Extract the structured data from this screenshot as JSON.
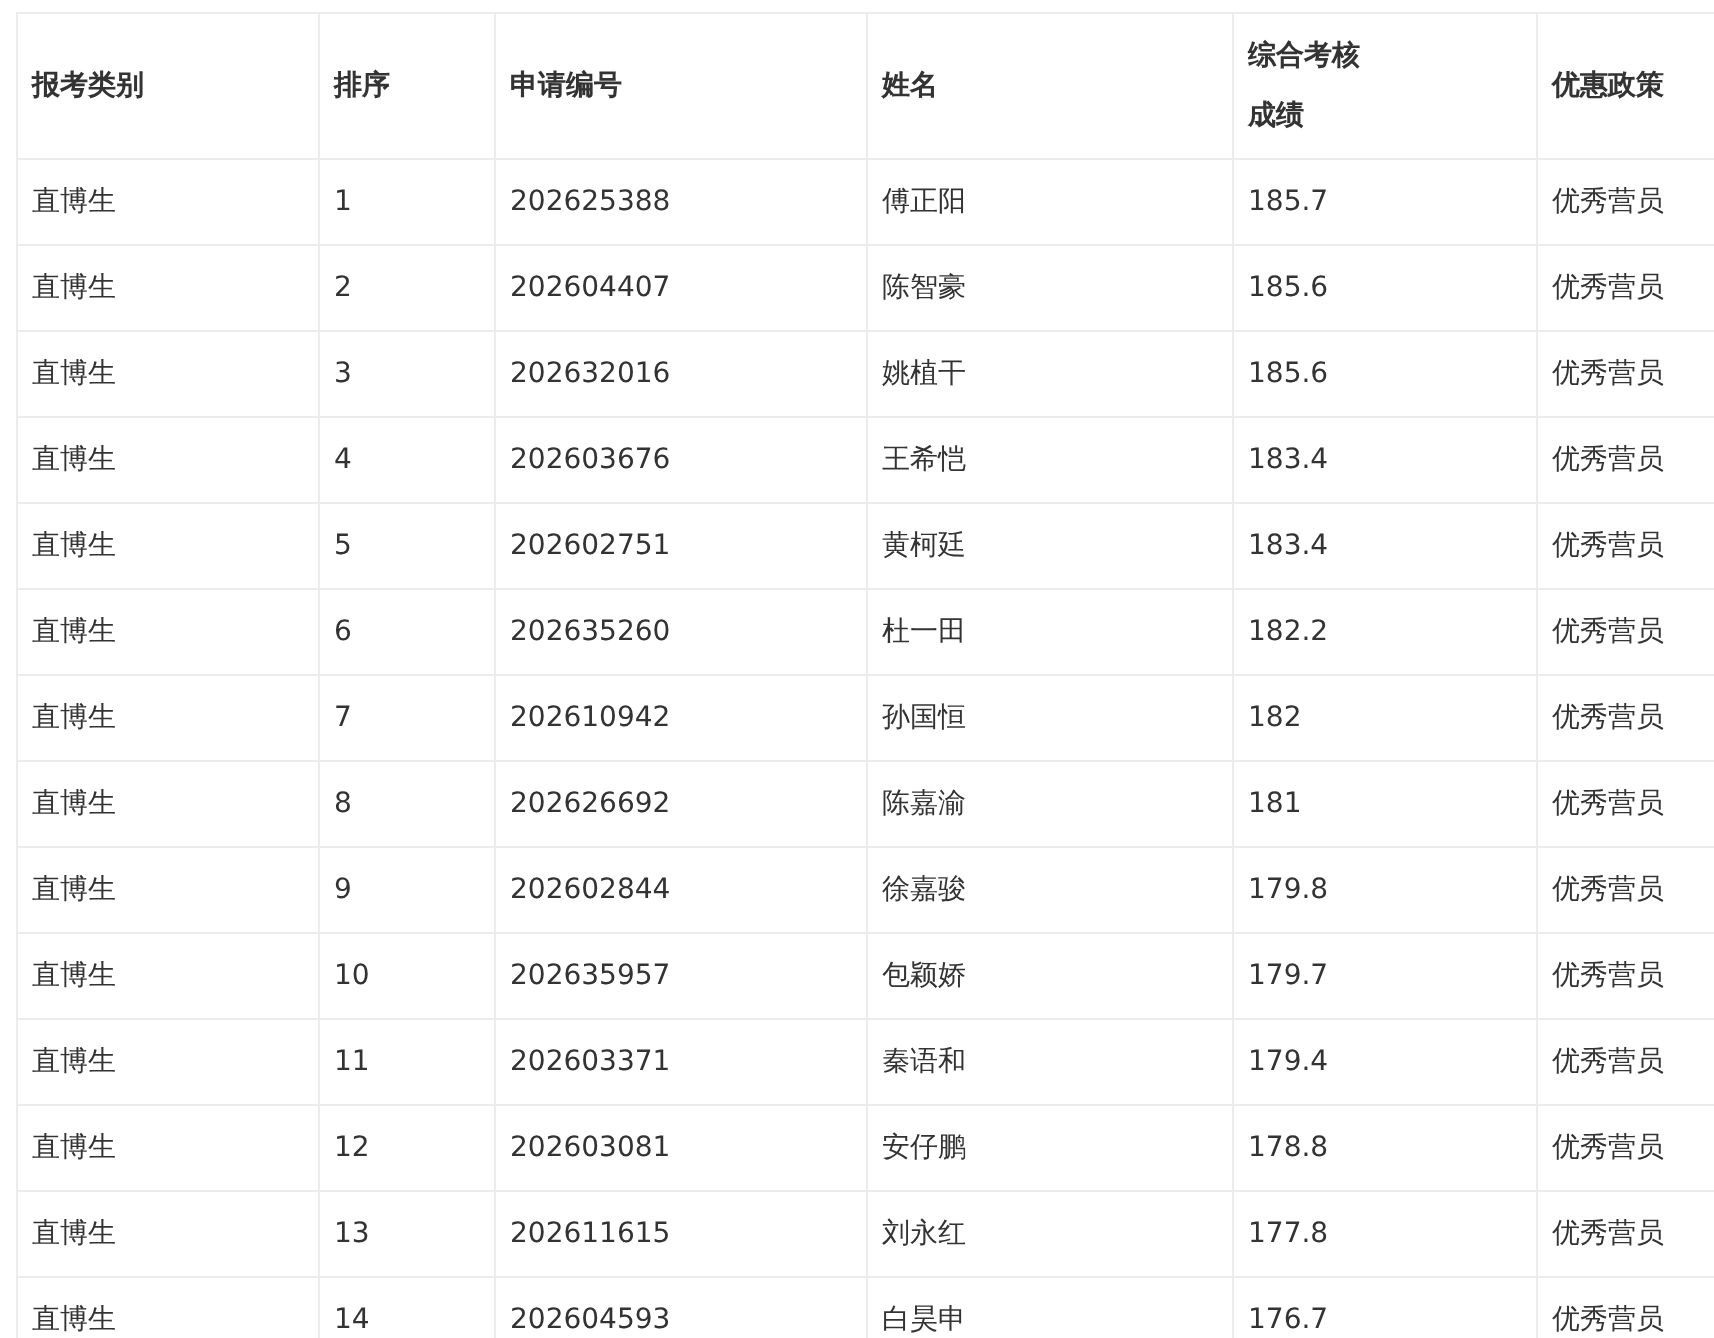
{
  "table": {
    "columns": [
      "报考类别",
      "排序",
      "申请编号",
      "姓名",
      "综合考核成绩",
      "优惠政策"
    ],
    "rows": [
      [
        "直博生",
        "1",
        "202625388",
        "傅正阳",
        "185.7",
        "优秀营员"
      ],
      [
        "直博生",
        "2",
        "202604407",
        "陈智豪",
        "185.6",
        "优秀营员"
      ],
      [
        "直博生",
        "3",
        "202632016",
        "姚植干",
        "185.6",
        "优秀营员"
      ],
      [
        "直博生",
        "4",
        "202603676",
        "王希恺",
        "183.4",
        "优秀营员"
      ],
      [
        "直博生",
        "5",
        "202602751",
        "黄柯廷",
        "183.4",
        "优秀营员"
      ],
      [
        "直博生",
        "6",
        "202635260",
        "杜一田",
        "182.2",
        "优秀营员"
      ],
      [
        "直博生",
        "7",
        "202610942",
        "孙国恒",
        "182",
        "优秀营员"
      ],
      [
        "直博生",
        "8",
        "202626692",
        "陈嘉渝",
        "181",
        "优秀营员"
      ],
      [
        "直博生",
        "9",
        "202602844",
        "徐嘉骏",
        "179.8",
        "优秀营员"
      ],
      [
        "直博生",
        "10",
        "202635957",
        "包颖娇",
        "179.7",
        "优秀营员"
      ],
      [
        "直博生",
        "11",
        "202603371",
        "秦语和",
        "179.4",
        "优秀营员"
      ],
      [
        "直博生",
        "12",
        "202603081",
        "安仔鹏",
        "178.8",
        "优秀营员"
      ],
      [
        "直博生",
        "13",
        "202611615",
        "刘永红",
        "177.8",
        "优秀营员"
      ],
      [
        "直博生",
        "14",
        "202604593",
        "白昊申",
        "176.7",
        "优秀营员"
      ]
    ]
  }
}
